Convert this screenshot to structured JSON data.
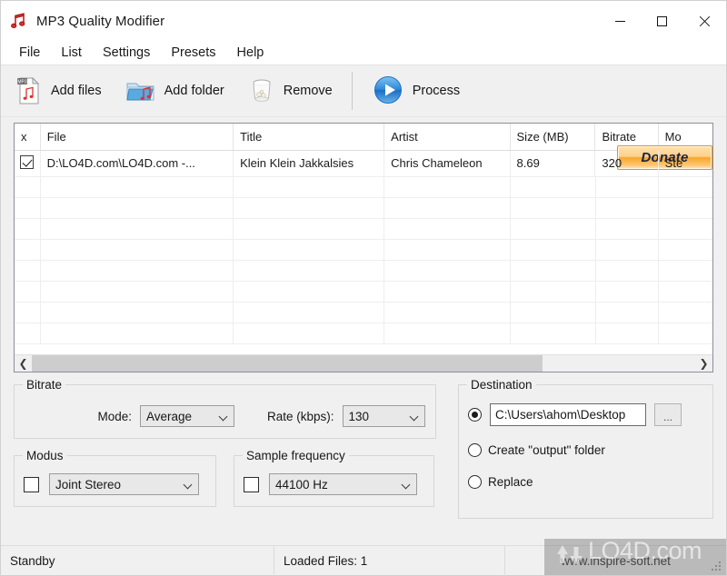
{
  "window": {
    "title": "MP3 Quality Modifier",
    "icon": "music-note-icon",
    "controls": {
      "minimize": "–",
      "maximize": "□",
      "close": "✕"
    }
  },
  "menubar": {
    "items": [
      {
        "label": "File"
      },
      {
        "label": "List"
      },
      {
        "label": "Settings"
      },
      {
        "label": "Presets"
      },
      {
        "label": "Help"
      }
    ]
  },
  "toolbar": {
    "buttons": [
      {
        "label": "Add files",
        "icon": "mp3-file-icon"
      },
      {
        "label": "Add folder",
        "icon": "music-folder-icon"
      },
      {
        "label": "Remove",
        "icon": "trash-bin-icon"
      },
      {
        "label": "Process",
        "icon": "play-circle-icon"
      }
    ],
    "donate_label": "Donate"
  },
  "file_list": {
    "columns": [
      "x",
      "File",
      "Title",
      "Artist",
      "Size  (MB)",
      "Bitrate",
      "Mo"
    ],
    "rows": [
      {
        "checked": true,
        "file": "D:\\LO4D.com\\LO4D.com -...",
        "title": "Klein Klein Jakkalsies",
        "artist": "Chris Chameleon",
        "size": "8.69",
        "bitrate": "320",
        "mode": "Ste"
      }
    ],
    "empty_row_count": 8,
    "scroll_left_icon": "chevron-left-icon",
    "scroll_right_icon": "chevron-right-icon"
  },
  "bitrate_group": {
    "caption": "Bitrate",
    "mode_label": "Mode:",
    "mode_value": "Average",
    "rate_label": "Rate (kbps):",
    "rate_value": "130"
  },
  "modus_group": {
    "caption": "Modus",
    "checked": false,
    "value": "Joint Stereo"
  },
  "sample_group": {
    "caption": "Sample frequency",
    "checked": false,
    "value": "44100 Hz"
  },
  "destination_group": {
    "caption": "Destination",
    "selected": "path",
    "path_value": "C:\\Users\\ahom\\Desktop",
    "browse_label": "...",
    "option_output": "Create \"output\" folder",
    "option_replace": "Replace"
  },
  "statusbar": {
    "status": "Standby",
    "loaded": "Loaded Files: 1",
    "website": "www.inspire-soft.net"
  },
  "watermark": {
    "text": "LO4D.com"
  },
  "colors": {
    "accent_blue": "#2f88d8",
    "donate_orange": "#f9a529",
    "titlebar_bg": "#ffffff",
    "window_bg": "#f0f0f0"
  }
}
